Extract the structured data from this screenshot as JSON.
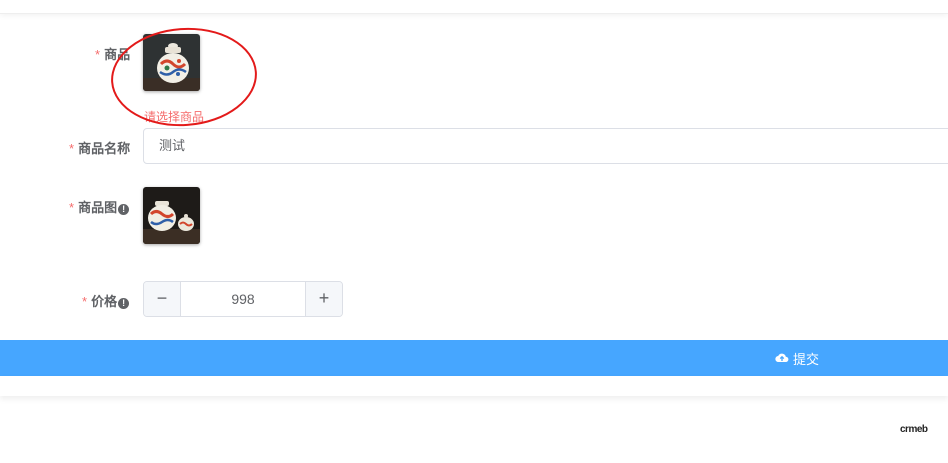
{
  "form": {
    "product": {
      "label": "商品",
      "error": "请选择商品"
    },
    "product_name": {
      "label": "商品名称",
      "value": "测试"
    },
    "product_image": {
      "label": "商品图"
    },
    "price": {
      "label": "价格",
      "value": "998",
      "minus": "−",
      "plus": "+"
    },
    "required_mark": "*",
    "info_glyph": "!"
  },
  "submit": {
    "label": "提交",
    "icon": "cloud-upload-icon"
  },
  "brand": {
    "logo_text": "crmeb"
  },
  "colors": {
    "submit_bar": "#46a6ff",
    "required": "#f56c6c",
    "annotation": "#e31a1a"
  }
}
